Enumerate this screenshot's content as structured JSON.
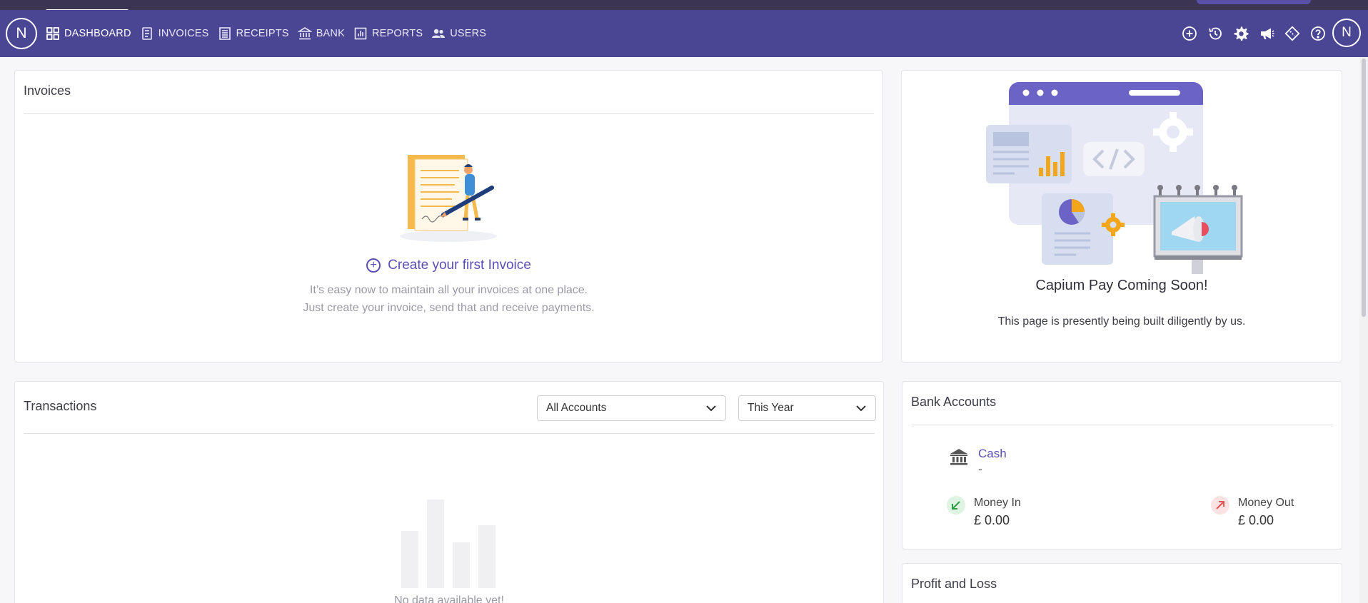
{
  "nav": {
    "avatar_initial": "N",
    "items": [
      {
        "label": "DASHBOARD",
        "icon": "dashboard-grid-icon",
        "active": true
      },
      {
        "label": "INVOICES",
        "icon": "invoice-icon"
      },
      {
        "label": "RECEIPTS",
        "icon": "receipt-icon"
      },
      {
        "label": "BANK",
        "icon": "bank-icon"
      },
      {
        "label": "REPORTS",
        "icon": "reports-chart-icon"
      },
      {
        "label": "USERS",
        "icon": "users-icon"
      }
    ],
    "right_icons": [
      "add-circle-icon",
      "history-icon",
      "gear-icon",
      "megaphone-icon",
      "ticket-icon",
      "help-icon"
    ],
    "user_initial": "N",
    "color": "#4b4694"
  },
  "invoices": {
    "title": "Invoices",
    "create_label": "Create your first Invoice",
    "desc_line1": "It’s easy now to maintain all your invoices at one place.",
    "desc_line2": "Just create your invoice, send that and receive payments."
  },
  "capium": {
    "title": "Capium Pay Coming Soon!",
    "desc": "This page is presently being built diligently by us."
  },
  "transactions": {
    "title": "Transactions",
    "account_filter": "All Accounts",
    "period_filter": "This Year",
    "empty_text": "No data available yet!"
  },
  "bank": {
    "title": "Bank Accounts",
    "account_name": "Cash",
    "account_value": "-",
    "money_in_label": "Money In",
    "money_in_amount": "£ 0.00",
    "money_out_label": "Money Out",
    "money_out_amount": "£ 0.00"
  },
  "profit_loss": {
    "title": "Profit and Loss"
  },
  "colors": {
    "accent": "#5b4fb3",
    "money_in": "#2e9e44",
    "money_out": "#e25555"
  }
}
